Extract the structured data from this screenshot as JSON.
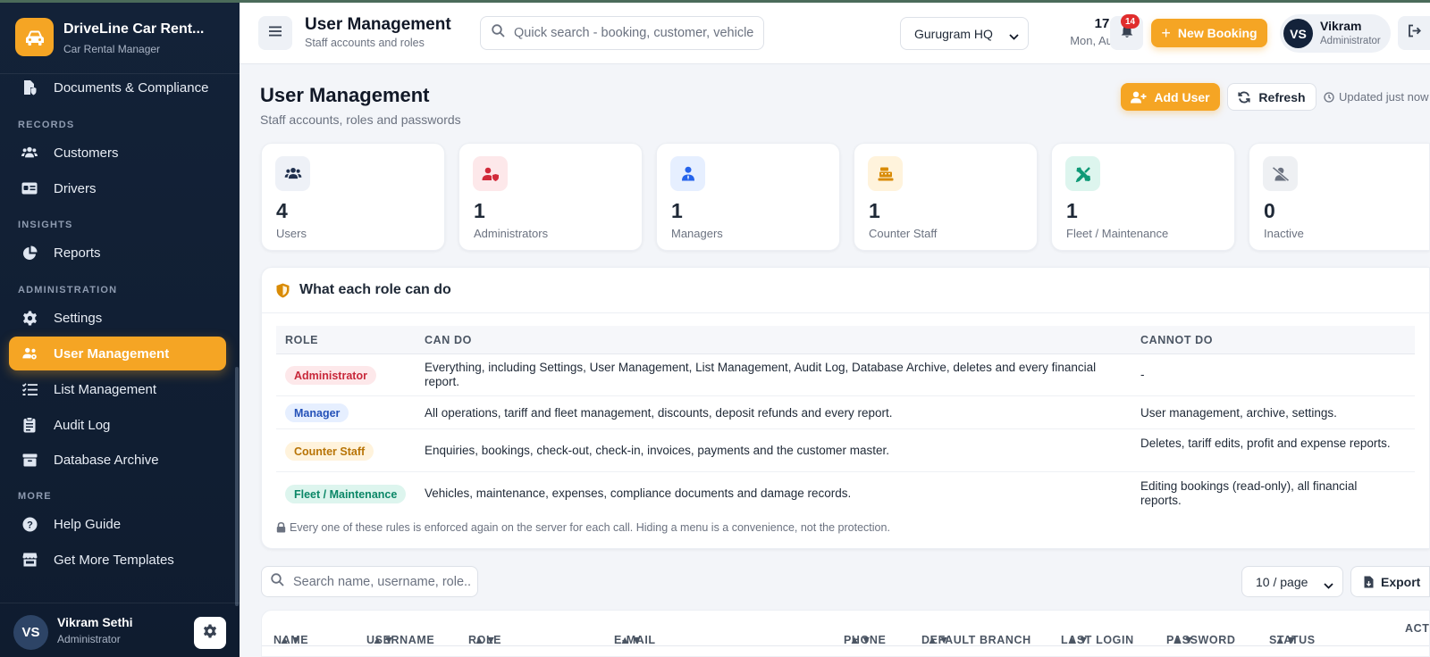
{
  "brand": {
    "name": "DriveLine Car Rent...",
    "subtitle": "Car Rental Manager"
  },
  "sidebar": {
    "items": [
      {
        "label": "Documents & Compliance",
        "icon": "file-shield-icon"
      },
      {
        "label": "Customers",
        "icon": "users-icon"
      },
      {
        "label": "Drivers",
        "icon": "id-card-icon"
      },
      {
        "label": "Reports",
        "icon": "pie-chart-icon"
      },
      {
        "label": "Settings",
        "icon": "gear-icon"
      },
      {
        "label": "User Management",
        "icon": "users-gear-icon",
        "active": true
      },
      {
        "label": "List Management",
        "icon": "list-icon"
      },
      {
        "label": "Audit Log",
        "icon": "clipboard-icon"
      },
      {
        "label": "Database Archive",
        "icon": "archive-icon"
      },
      {
        "label": "Help Guide",
        "icon": "question-circle-icon"
      },
      {
        "label": "Get More Templates",
        "icon": "store-icon"
      }
    ],
    "sections": [
      "RECORDS",
      "INSIGHTS",
      "ADMINISTRATION",
      "MORE"
    ],
    "user": {
      "initials": "VS",
      "name": "Vikram Sethi",
      "role": "Administrator"
    }
  },
  "header": {
    "title": "User Management",
    "subtitle": "Staff accounts and roles",
    "search_placeholder": "Quick search - booking, customer, vehicle",
    "branch": "Gurugram HQ",
    "time": "17:00",
    "date": "Mon, Aug 3",
    "notifications": "14",
    "new_booking": "New Booking",
    "user": {
      "initials": "VS",
      "name": "Vikram",
      "role": "Administrator"
    }
  },
  "page": {
    "title": "User Management",
    "subtitle": "Staff accounts, roles and passwords",
    "add_user": "Add User",
    "refresh": "Refresh",
    "updated": "Updated just now"
  },
  "stats": [
    {
      "value": "4",
      "label": "Users",
      "icon": "users-icon",
      "bg": "#eef1f7",
      "fg": "#1f2f4d"
    },
    {
      "value": "1",
      "label": "Administrators",
      "icon": "user-shield-icon",
      "bg": "#fde8ea",
      "fg": "#d12a3a"
    },
    {
      "value": "1",
      "label": "Managers",
      "icon": "user-tie-icon",
      "bg": "#e6efff",
      "fg": "#2563eb"
    },
    {
      "value": "1",
      "label": "Counter Staff",
      "icon": "cash-register-icon",
      "bg": "#fff3dc",
      "fg": "#d98b06"
    },
    {
      "value": "1",
      "label": "Fleet / Maintenance",
      "icon": "tools-icon",
      "bg": "#ddf5ee",
      "fg": "#0f9a77"
    },
    {
      "value": "0",
      "label": "Inactive",
      "icon": "user-slash-icon",
      "bg": "#eef0f3",
      "fg": "#6b7280"
    }
  ],
  "roles": {
    "title": "What each role can do",
    "columns": [
      "ROLE",
      "CAN DO",
      "CANNOT DO"
    ],
    "rows": [
      {
        "role": "Administrator",
        "can": "Everything, including Settings, User Management, List Management, Audit Log, Database Archive, deletes and every financial report.",
        "cannot": "-",
        "chip_bg": "#fde8ea",
        "chip_fg": "#c8283a"
      },
      {
        "role": "Manager",
        "can": "All operations, tariff and fleet management, discounts, deposit refunds and every report.",
        "cannot": "User management, archive, settings.",
        "chip_bg": "#e6efff",
        "chip_fg": "#2451b8"
      },
      {
        "role": "Counter Staff",
        "can": "Enquiries, bookings, check-out, check-in, invoices, payments and the customer master.",
        "cannot": "Deletes, tariff edits, profit and expense reports.",
        "chip_bg": "#fff3dc",
        "chip_fg": "#b87406"
      },
      {
        "role": "Fleet / Maintenance",
        "can": "Vehicles, maintenance, expenses, compliance documents and damage records.",
        "cannot": "Editing bookings (read-only), all financial reports.",
        "chip_bg": "#ddf5ee",
        "chip_fg": "#0b8767"
      }
    ],
    "note": "Every one of these rules is enforced again on the server for each call. Hiding a menu is a convenience, not the protection."
  },
  "table_tools": {
    "search_placeholder": "Search name, username, role...",
    "per_page": "10 / page",
    "export": "Export"
  },
  "users_table": {
    "columns": [
      "NAME",
      "USERNAME",
      "ROLE",
      "E-MAIL",
      "PHONE",
      "DEFAULT BRANCH",
      "LAST LOGIN",
      "PASSWORD",
      "STATUS",
      "ACT"
    ]
  },
  "colors": {
    "accent": "#f5a524",
    "sidebar": "#132238"
  }
}
